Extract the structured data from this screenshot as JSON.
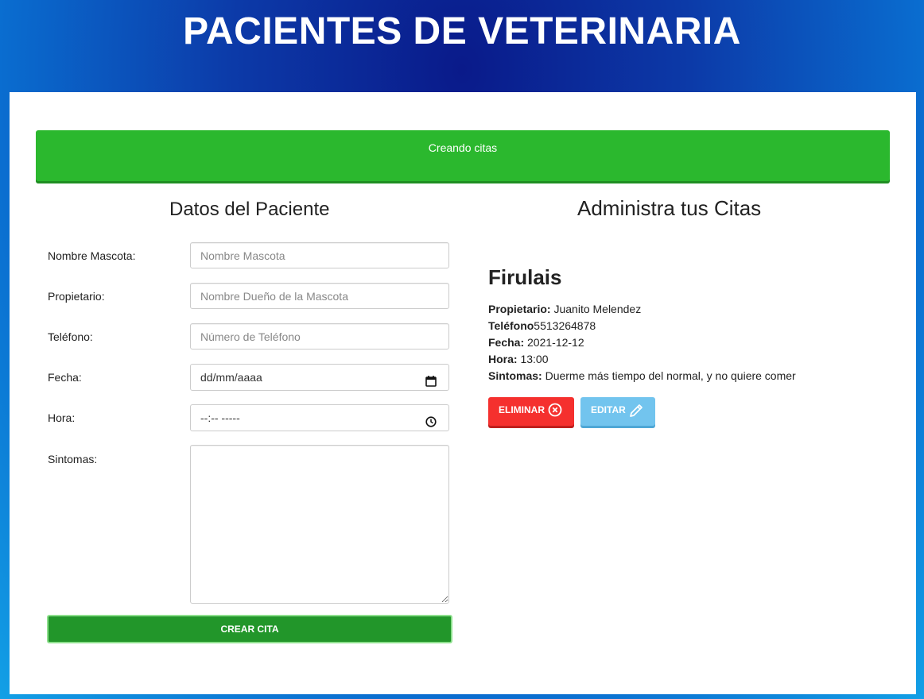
{
  "header": {
    "title": "PACIENTES DE VETERINARIA"
  },
  "alert": {
    "text": "Creando citas"
  },
  "form": {
    "title": "Datos del Paciente",
    "fields": [
      {
        "label": "Nombre Mascota:",
        "placeholder": "Nombre Mascota"
      },
      {
        "label": "Propietario:",
        "placeholder": "Nombre Dueño de la Mascota"
      },
      {
        "label": "Teléfono:",
        "placeholder": "Número de Teléfono"
      },
      {
        "label": "Fecha:",
        "value": "dd/mm/aaaa"
      },
      {
        "label": "Hora:",
        "value": "--:-- -----"
      },
      {
        "label": "Sintomas:",
        "value": ""
      }
    ],
    "submit_label": "CREAR CITA"
  },
  "citas": {
    "title": "Administra tus Citas",
    "items": [
      {
        "mascota": "Firulais",
        "propietario_label": "Propietario:",
        "propietario": "Juanito Melendez",
        "telefono_label": "Teléfono",
        "telefono": "5513264878",
        "fecha_label": "Fecha:",
        "fecha": "2021-12-12",
        "hora_label": "Hora:",
        "hora": "13:00",
        "sintomas_label": "Sintomas:",
        "sintomas": "Duerme más tiempo del normal, y no quiere comer",
        "delete_label": "ELIMINAR",
        "edit_label": "EDITAR"
      }
    ]
  },
  "colors": {
    "alert_green": "#2bb82e",
    "submit_green": "#22962a",
    "delete_red": "#f5302e",
    "edit_blue": "#72c4ee"
  },
  "icons": {
    "delete": "circle-x-icon",
    "edit": "pencil-icon",
    "fecha": "calendar-icon",
    "hora": "clock-icon"
  }
}
